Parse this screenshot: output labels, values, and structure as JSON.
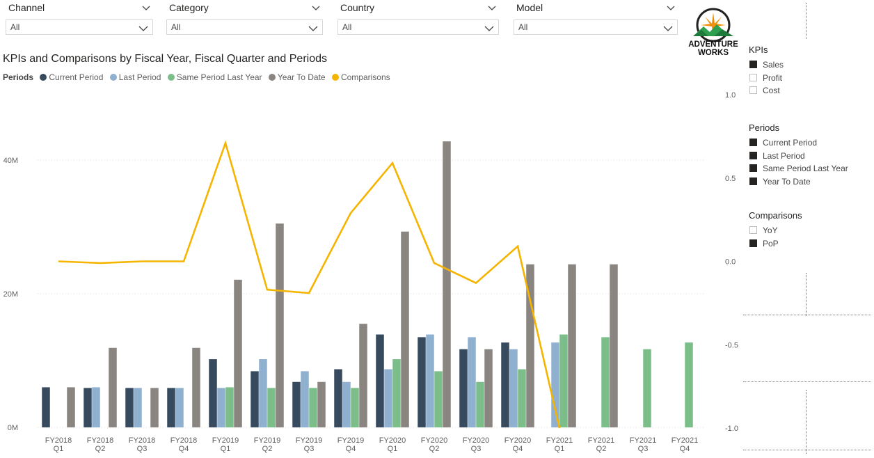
{
  "slicers": [
    {
      "label": "Channel",
      "value": "All"
    },
    {
      "label": "Category",
      "value": "All"
    },
    {
      "label": "Country",
      "value": "All"
    },
    {
      "label": "Model",
      "value": "All"
    }
  ],
  "logo": {
    "line1": "ADVENTURE",
    "line2": "WORKS"
  },
  "legend": {
    "title": "Periods",
    "items": [
      {
        "name": "Current Period",
        "color": "#374a5e"
      },
      {
        "name": "Last Period",
        "color": "#8fb0cf"
      },
      {
        "name": "Same Period Last Year",
        "color": "#7cbe8a"
      },
      {
        "name": "Year To Date",
        "color": "#8a8580"
      },
      {
        "name": "Comparisons",
        "color": "#f5b400"
      }
    ]
  },
  "panels": {
    "kpis": {
      "title": "KPIs",
      "items": [
        {
          "label": "Sales",
          "checked": true
        },
        {
          "label": "Profit",
          "checked": false
        },
        {
          "label": "Cost",
          "checked": false
        }
      ]
    },
    "periods": {
      "title": "Periods",
      "items": [
        {
          "label": "Current Period",
          "checked": true
        },
        {
          "label": "Last Period",
          "checked": true
        },
        {
          "label": "Same Period Last Year",
          "checked": true
        },
        {
          "label": "Year To Date",
          "checked": true
        }
      ]
    },
    "comparisons": {
      "title": "Comparisons",
      "items": [
        {
          "label": "YoY",
          "checked": false
        },
        {
          "label": "PoP",
          "checked": true
        }
      ]
    }
  },
  "chart_data": {
    "type": "bar",
    "title": "KPIs and Comparisons by Fiscal Year, Fiscal Quarter and Periods",
    "categories": [
      [
        "FY2018",
        "Q1"
      ],
      [
        "FY2018",
        "Q2"
      ],
      [
        "FY2018",
        "Q3"
      ],
      [
        "FY2018",
        "Q4"
      ],
      [
        "FY2019",
        "Q1"
      ],
      [
        "FY2019",
        "Q2"
      ],
      [
        "FY2019",
        "Q3"
      ],
      [
        "FY2019",
        "Q4"
      ],
      [
        "FY2020",
        "Q1"
      ],
      [
        "FY2020",
        "Q2"
      ],
      [
        "FY2020",
        "Q3"
      ],
      [
        "FY2020",
        "Q4"
      ],
      [
        "FY2021",
        "Q1"
      ],
      [
        "FY2021",
        "Q2"
      ],
      [
        "FY2021",
        "Q3"
      ],
      [
        "FY2021",
        "Q4"
      ]
    ],
    "series": [
      {
        "name": "Current Period",
        "color": "#374a5e",
        "values": [
          6.0,
          5.9,
          5.9,
          5.9,
          10.2,
          8.4,
          6.8,
          8.7,
          13.9,
          13.5,
          11.7,
          12.7,
          null,
          null,
          null,
          null
        ]
      },
      {
        "name": "Last Period",
        "color": "#8fb0cf",
        "values": [
          null,
          6.0,
          5.9,
          5.9,
          5.9,
          10.2,
          8.4,
          6.8,
          8.7,
          13.9,
          13.5,
          11.7,
          12.7,
          null,
          null,
          null
        ]
      },
      {
        "name": "Same Period Last Year",
        "color": "#7cbe8a",
        "values": [
          null,
          null,
          null,
          null,
          6.0,
          5.9,
          5.9,
          5.9,
          10.2,
          8.4,
          6.8,
          8.7,
          13.9,
          13.5,
          11.7,
          12.7
        ]
      },
      {
        "name": "Year To Date",
        "color": "#8a8580",
        "values": [
          6.0,
          11.9,
          5.9,
          11.9,
          22.1,
          30.5,
          6.8,
          15.5,
          29.3,
          42.8,
          11.7,
          24.4,
          24.4,
          24.4,
          null,
          null
        ]
      }
    ],
    "line": {
      "name": "Comparisons",
      "color": "#f5b400",
      "values": [
        0.0,
        -0.01,
        0.0,
        0.0,
        0.71,
        -0.17,
        -0.19,
        0.29,
        0.59,
        -0.01,
        -0.13,
        0.09,
        -1.0,
        null,
        null,
        null
      ]
    },
    "y_left": {
      "ticks": [
        0,
        20,
        40
      ],
      "tick_labels": [
        "0M",
        "20M",
        "40M"
      ],
      "range": [
        0,
        53
      ]
    },
    "y_right": {
      "ticks": [
        1.0,
        0.5,
        0.0,
        -0.5,
        -1.0
      ],
      "tick_labels": [
        "1.0",
        "0.5",
        "0.0",
        "-0.5",
        "-1.0"
      ],
      "range": [
        -1.0,
        1.0
      ]
    },
    "grid": true,
    "legend_position": "top-left"
  }
}
